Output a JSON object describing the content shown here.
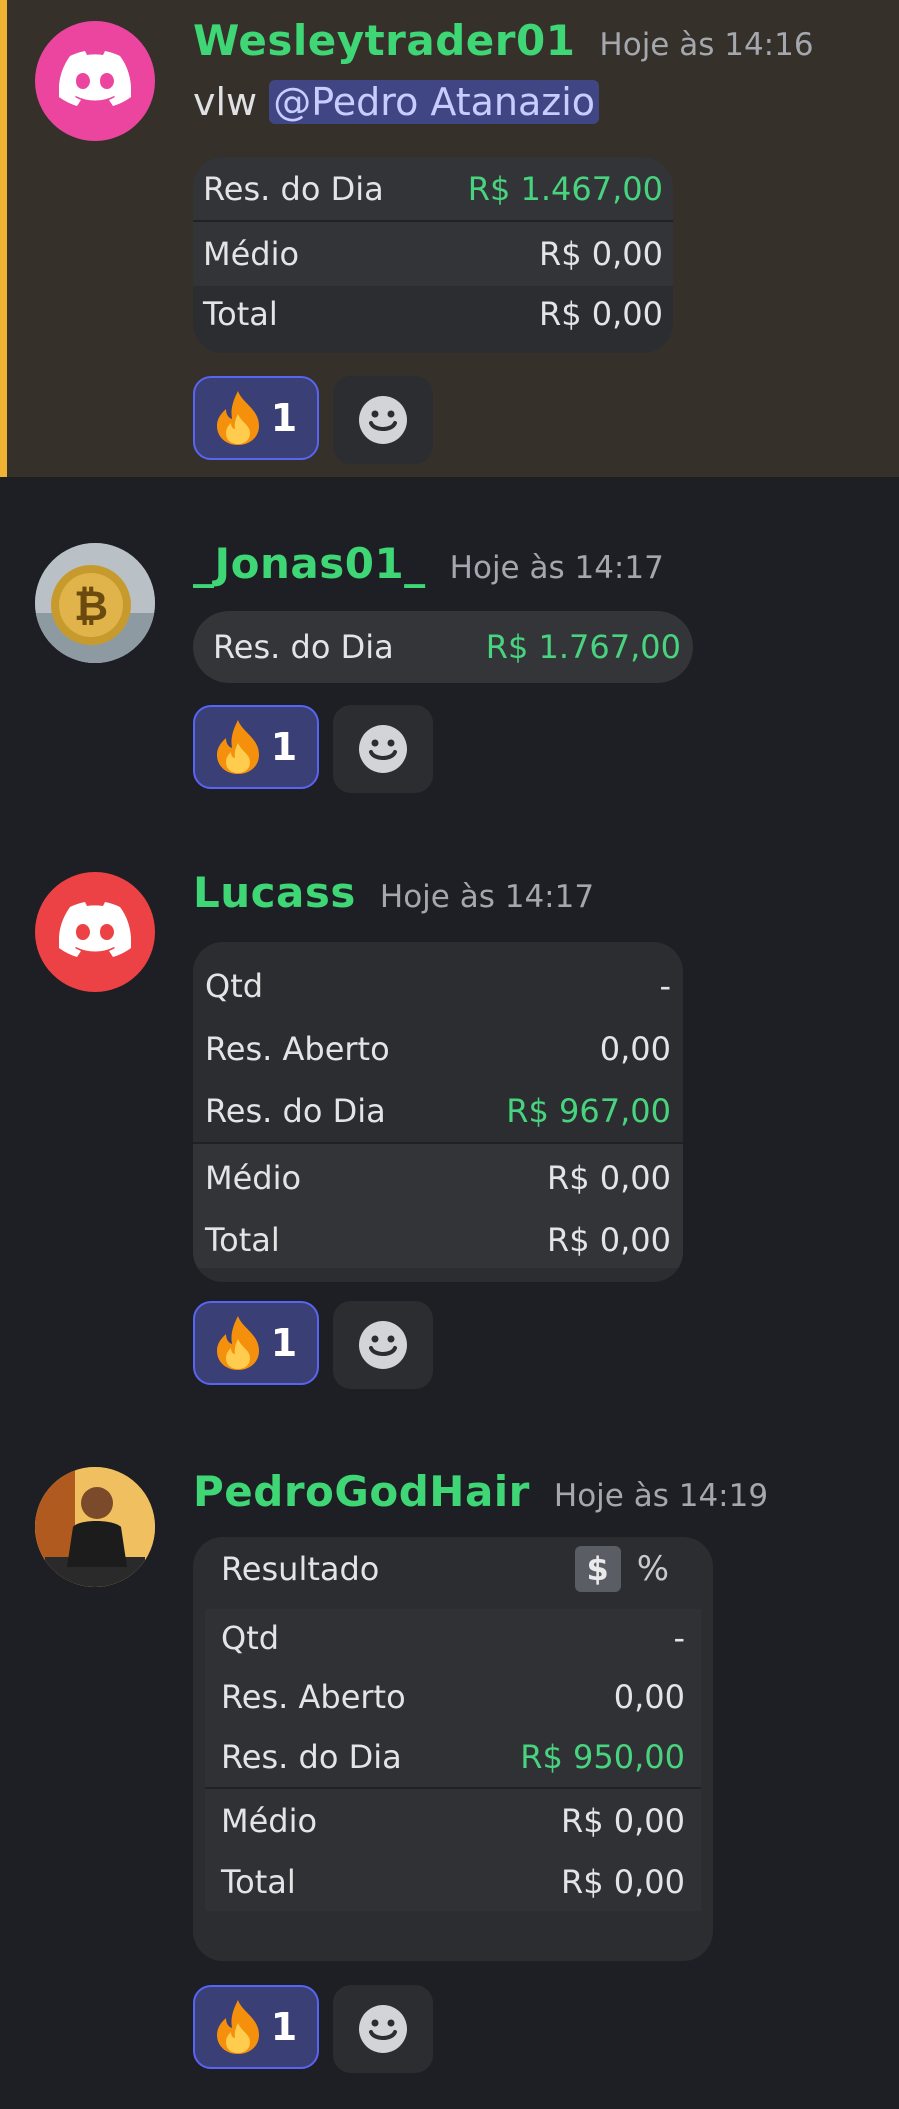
{
  "messages": [
    {
      "username": "Wesleytrader01",
      "timestamp": "Hoje às 14:16",
      "text": "vlw",
      "mention": "@Pedro Atanazio",
      "card": {
        "rows": [
          {
            "label": "Res. do Dia",
            "value": "R$ 1.467,00"
          },
          {
            "label": "Médio",
            "value": "R$ 0,00"
          },
          {
            "label": "Total",
            "value": "R$ 0,00"
          }
        ]
      },
      "reaction_count": "1"
    },
    {
      "username": "_Jonas01_",
      "timestamp": "Hoje às 14:17",
      "card": {
        "rows": [
          {
            "label": "Res. do Dia",
            "value": "R$ 1.767,00"
          }
        ]
      },
      "reaction_count": "1"
    },
    {
      "username": "Lucass",
      "timestamp": "Hoje às 14:17",
      "card": {
        "rows": [
          {
            "label": "Qtd",
            "value": "-"
          },
          {
            "label": "Res. Aberto",
            "value": "0,00"
          },
          {
            "label": "Res. do Dia",
            "value": "R$ 967,00"
          },
          {
            "label": "Médio",
            "value": "R$ 0,00"
          },
          {
            "label": "Total",
            "value": "R$ 0,00"
          }
        ]
      },
      "reaction_count": "1"
    },
    {
      "username": "PedroGodHair",
      "timestamp": "Hoje às 14:19",
      "card": {
        "header_label": "Resultado",
        "toggle_dollar": "$",
        "toggle_percent": "%",
        "rows": [
          {
            "label": "Qtd",
            "value": "-"
          },
          {
            "label": "Res. Aberto",
            "value": "0,00"
          },
          {
            "label": "Res. do Dia",
            "value": "R$ 950,00"
          },
          {
            "label": "Médio",
            "value": "R$ 0,00"
          },
          {
            "label": "Total",
            "value": "R$ 0,00"
          }
        ]
      },
      "reaction_count": "1"
    }
  ],
  "colors": {
    "username": "#3fd676",
    "positive_value": "#48d47e",
    "highlight_bar": "#f0b232",
    "reaction_active": "#3a3f75"
  },
  "icons": [
    "discord-logo-icon",
    "fire-emoji-icon",
    "add-reaction-icon",
    "bitcoin-avatar",
    "user-photo-avatar"
  ]
}
